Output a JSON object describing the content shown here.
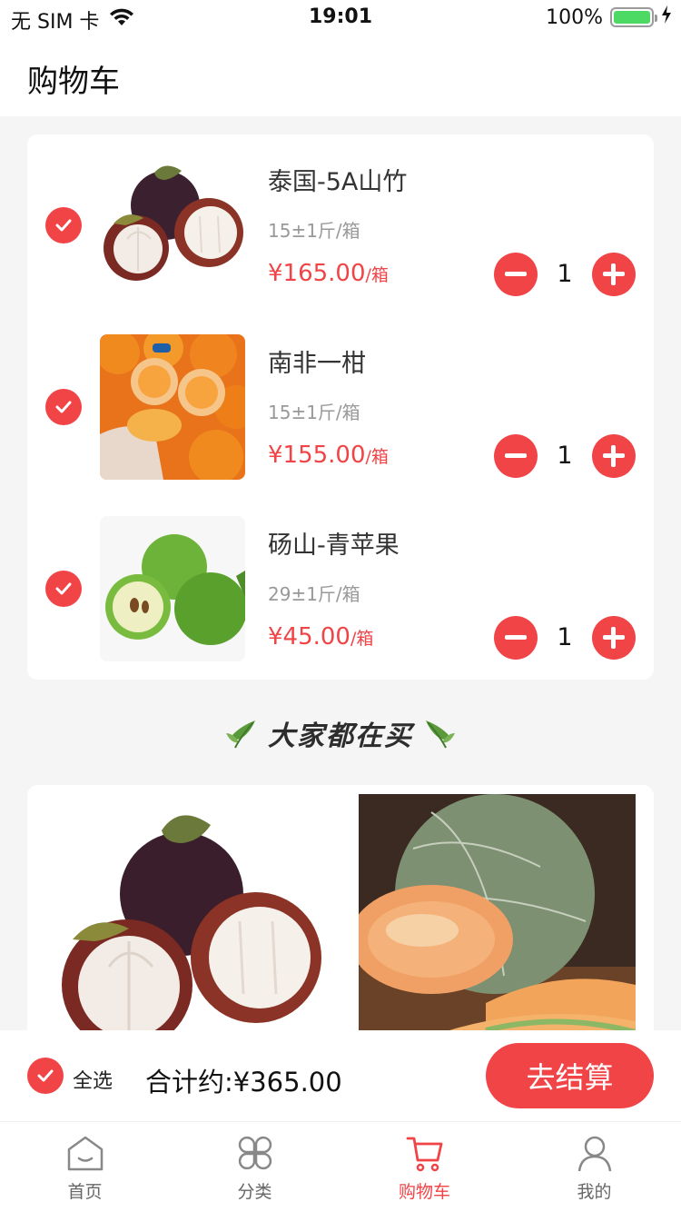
{
  "status_bar": {
    "carrier": "无 SIM 卡",
    "time": "19:01",
    "battery_text": "100%"
  },
  "header": {
    "title": "购物车"
  },
  "cart": {
    "items": [
      {
        "name": "泰国-5A山竹",
        "spec": "15±1斤/箱",
        "price": "¥165.00",
        "unit": "/箱",
        "qty": "1",
        "image": "mangosteen"
      },
      {
        "name": "南非一柑",
        "spec": "15±1斤/箱",
        "price": "¥155.00",
        "unit": "/箱",
        "qty": "1",
        "image": "oranges"
      },
      {
        "name": "砀山-青苹果",
        "spec": "29±1斤/箱",
        "price": "¥45.00",
        "unit": "/箱",
        "qty": "1",
        "image": "green-apples"
      }
    ]
  },
  "recommend": {
    "title": "大家都在买",
    "images": [
      "mangosteen",
      "cantaloupe"
    ]
  },
  "checkout": {
    "select_all": "全选",
    "total": "合计约:¥365.00",
    "pay_label": "去结算"
  },
  "tabbar": {
    "tabs": [
      {
        "label": "首页",
        "icon": "home-icon"
      },
      {
        "label": "分类",
        "icon": "category-icon"
      },
      {
        "label": "购物车",
        "icon": "cart-icon",
        "active": true
      },
      {
        "label": "我的",
        "icon": "user-icon"
      }
    ]
  },
  "colors": {
    "accent": "#f04447",
    "background": "#f5f5f5"
  }
}
